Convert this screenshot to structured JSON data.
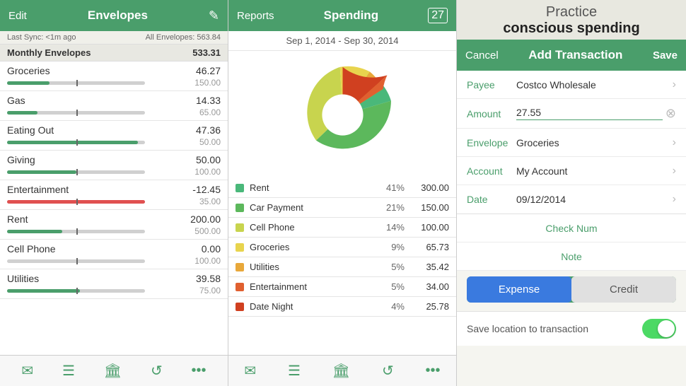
{
  "panel1": {
    "header": {
      "edit": "Edit",
      "title": "Envelopes",
      "editIconSymbol": "✎"
    },
    "sync": {
      "last_sync": "Last Sync: <1m ago",
      "all_envelopes": "All Envelopes: 563.84"
    },
    "monthly_envelopes": {
      "label": "Monthly Envelopes",
      "value": "533.31"
    },
    "envelopes": [
      {
        "name": "Groceries",
        "amount": "46.27",
        "budget": "150.00",
        "pct": 0.31,
        "color": "green"
      },
      {
        "name": "Gas",
        "amount": "14.33",
        "budget": "65.00",
        "pct": 0.22,
        "color": "green"
      },
      {
        "name": "Eating Out",
        "amount": "47.36",
        "budget": "50.00",
        "pct": 0.95,
        "color": "green"
      },
      {
        "name": "Giving",
        "amount": "50.00",
        "budget": "100.00",
        "pct": 0.5,
        "color": "green"
      },
      {
        "name": "Entertainment",
        "amount": "-12.45",
        "budget": "35.00",
        "pct": 1.0,
        "color": "red"
      },
      {
        "name": "Rent",
        "amount": "200.00",
        "budget": "500.00",
        "pct": 0.4,
        "color": "green"
      },
      {
        "name": "Cell Phone",
        "amount": "0.00",
        "budget": "100.00",
        "pct": 0.0,
        "color": "green"
      },
      {
        "name": "Utilities",
        "amount": "39.58",
        "budget": "75.00",
        "pct": 0.53,
        "color": "green"
      }
    ],
    "tabbar": {
      "icons": [
        "✉",
        "☰",
        "🏛",
        "↺",
        "•••"
      ]
    }
  },
  "panel2": {
    "header": {
      "reports": "Reports",
      "title": "Spending",
      "calSymbol": "27"
    },
    "date_range": "Sep 1, 2014 - Sep 30, 2014",
    "spending_items": [
      {
        "name": "Rent",
        "pct": "41%",
        "value": "300.00",
        "color": "#4ab87a"
      },
      {
        "name": "Car Payment",
        "pct": "21%",
        "value": "150.00",
        "color": "#5cb85c"
      },
      {
        "name": "Cell Phone",
        "pct": "14%",
        "value": "100.00",
        "color": "#c8d44e"
      },
      {
        "name": "Groceries",
        "pct": "9%",
        "value": "65.73",
        "color": "#e8d44e"
      },
      {
        "name": "Utilities",
        "pct": "5%",
        "value": "35.42",
        "color": "#e8a83a"
      },
      {
        "name": "Entertainment",
        "pct": "5%",
        "value": "34.00",
        "color": "#e06030"
      },
      {
        "name": "Date Night",
        "pct": "4%",
        "value": "25.78",
        "color": "#d04020"
      }
    ],
    "tabbar_icons": [
      "✉",
      "☰",
      "🏛",
      "↺",
      "•••"
    ]
  },
  "panel3": {
    "promo": {
      "light": "Practice",
      "bold": "conscious spending"
    },
    "header": {
      "cancel": "Cancel",
      "title": "Add Transaction",
      "save": "Save"
    },
    "form": {
      "payee_label": "Payee",
      "payee_value": "Costco Wholesale",
      "amount_label": "Amount",
      "amount_value": "27.55",
      "envelope_label": "Envelope",
      "envelope_value": "Groceries",
      "account_label": "Account",
      "account_value": "My Account",
      "date_label": "Date",
      "date_value": "09/12/2014",
      "check_num_label": "Check Num",
      "note_label": "Note"
    },
    "toggle": {
      "expense": "Expense",
      "credit": "Credit"
    },
    "save_location": {
      "label": "Save location to transaction"
    }
  }
}
